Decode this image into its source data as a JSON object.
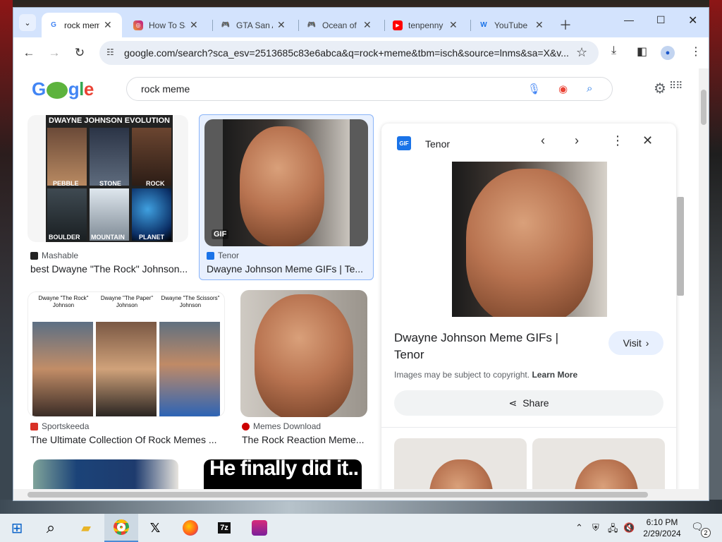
{
  "browser": {
    "tabs": [
      {
        "title": "rock meme",
        "favicon": "google-icon",
        "active": true
      },
      {
        "title": "How To Save",
        "favicon": "instagram-icon"
      },
      {
        "title": "GTA San Andreas",
        "favicon": "gamepad-icon"
      },
      {
        "title": "Ocean of Games",
        "favicon": "gamepad-icon"
      },
      {
        "title": "tenpenny",
        "favicon": "youtube-icon"
      },
      {
        "title": "YouTube",
        "favicon": "w-icon"
      }
    ],
    "url": "google.com/search?sca_esv=2513685c83e6abca&q=rock+meme&tbm=isch&source=lnms&sa=X&v..."
  },
  "google": {
    "logo": "Google",
    "query": "rock meme"
  },
  "results": [
    {
      "source": "Mashable",
      "title": "best Dwayne \"The Rock\" Johnson...",
      "thumb_caption": "DWAYNE JOHNSON EVOLUTION",
      "labels": [
        "PEBBLE",
        "STONE",
        "ROCK",
        "BOULDER",
        "MOUNTAIN",
        "PLANET"
      ]
    },
    {
      "source": "Tenor",
      "title": "Dwayne Johnson Meme GIFs | Te...",
      "badge": "GIF"
    },
    {
      "source": "Sportskeeda",
      "title": "The Ultimate Collection Of Rock Memes ...",
      "labels": [
        "Dwayne \"The Rock\" Johnson",
        "Dwayne \"The Paper\" Johnson",
        "Dwayne \"The Scissors\" Johnson"
      ]
    },
    {
      "source": "Memes Download",
      "title": "The Rock Reaction Meme..."
    },
    {
      "source": "",
      "title": ""
    },
    {
      "source": "",
      "title": "",
      "thumb_caption": "He finally did it.."
    }
  ],
  "panel": {
    "source": "Tenor",
    "favicon_text": "GIF",
    "title": "Dwayne Johnson Meme GIFs | Tenor",
    "visit_label": "Visit",
    "copyright": "Images may be subject to copyright.",
    "learn_more": "Learn More",
    "share_label": "Share"
  },
  "taskbar": {
    "time": "6:10 PM",
    "date": "2/29/2024",
    "notifications": "2"
  }
}
